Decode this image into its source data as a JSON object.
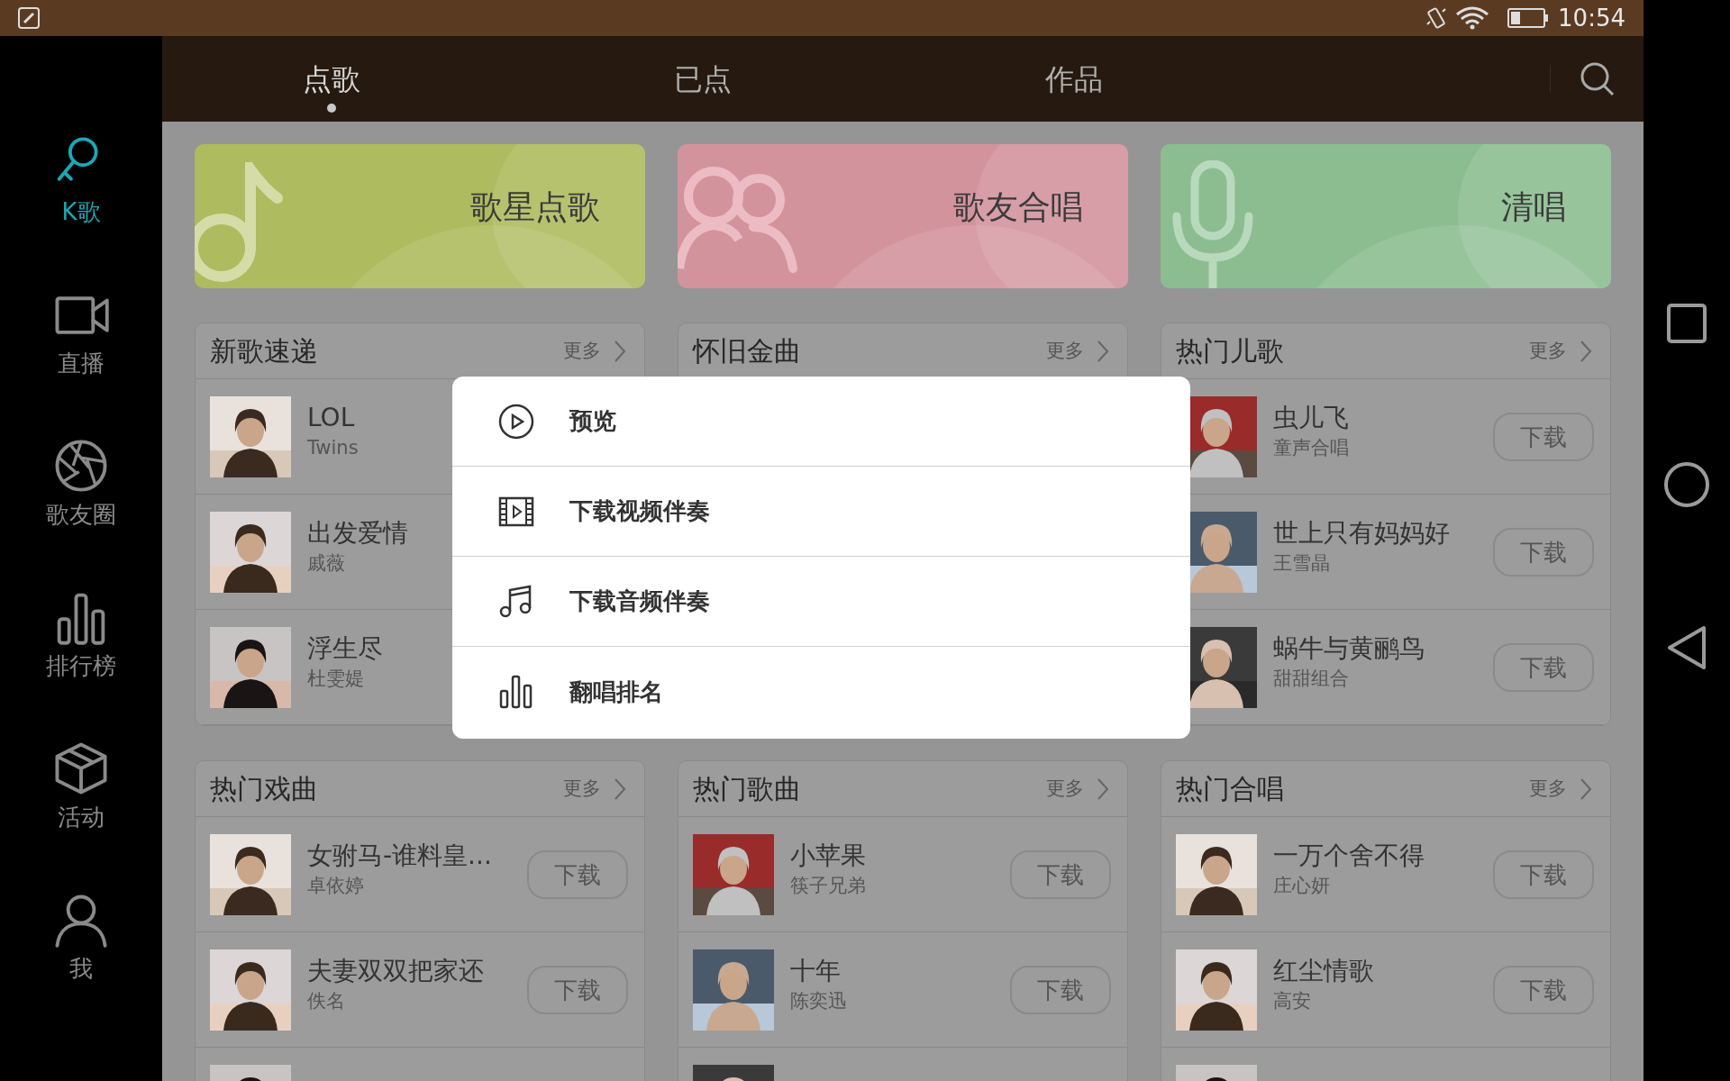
{
  "status_bar": {
    "time": "10:54"
  },
  "tabs": [
    {
      "label": "点歌",
      "selected": true
    },
    {
      "label": "已点",
      "selected": false
    },
    {
      "label": "作品",
      "selected": false
    }
  ],
  "sidebar": {
    "items": [
      {
        "label": "K歌",
        "kind": "mic",
        "selected": true
      },
      {
        "label": "直播",
        "kind": "camera",
        "selected": false
      },
      {
        "label": "歌友圈",
        "kind": "aperture",
        "selected": false
      },
      {
        "label": "排行榜",
        "kind": "bars",
        "selected": false
      },
      {
        "label": "活动",
        "kind": "box",
        "selected": false
      },
      {
        "label": "我",
        "kind": "person",
        "selected": false
      }
    ]
  },
  "banners": [
    {
      "label": "歌星点歌",
      "kind": "note",
      "color": "#aebb5e"
    },
    {
      "label": "歌友合唱",
      "kind": "people",
      "color": "#d3939d"
    },
    {
      "label": "清唱",
      "kind": "mic",
      "color": "#8cbd91"
    }
  ],
  "sections": [
    {
      "title": "新歌速递",
      "more": "更多",
      "rows": [
        {
          "kind": "song",
          "title": "LOL",
          "artist": "Twins"
        },
        {
          "kind": "song",
          "title": "出发爱情",
          "artist": "戚薇"
        },
        {
          "kind": "song",
          "title": "浮生尽",
          "artist": "杜雯媞"
        }
      ]
    },
    {
      "title": "怀旧金曲",
      "more": "更多"
    },
    {
      "title": "热门儿歌",
      "more": "更多",
      "rows": [
        {
          "kind": "song",
          "title": "虫儿飞",
          "artist": "童声合唱",
          "action": "下载"
        },
        {
          "kind": "song",
          "title": "世上只有妈妈好",
          "artist": "王雪晶",
          "action": "下载"
        },
        {
          "kind": "song",
          "title": "蜗牛与黄鹂鸟",
          "artist": "甜甜组合",
          "action": "下载"
        }
      ]
    },
    {
      "title": "热门戏曲",
      "more": "更多",
      "rows": [
        {
          "kind": "song",
          "title": "女驸马-谁料皇...",
          "artist": "卓依婷",
          "action": "下载"
        },
        {
          "kind": "song",
          "title": "夫妻双双把家还",
          "artist": "佚名",
          "action": "下载"
        },
        {
          "kind": "partial"
        }
      ]
    },
    {
      "title": "热门歌曲",
      "more": "更多",
      "rows": [
        {
          "kind": "song",
          "title": "小苹果",
          "artist": "筷子兄弟",
          "action": "下载"
        },
        {
          "kind": "song",
          "title": "十年",
          "artist": "陈奕迅",
          "action": "下载"
        },
        {
          "kind": "partial"
        }
      ]
    },
    {
      "title": "热门合唱",
      "more": "更多",
      "rows": [
        {
          "kind": "song",
          "title": "一万个舍不得",
          "artist": "庄心妍",
          "action": "下载"
        },
        {
          "kind": "song",
          "title": "红尘情歌",
          "artist": "高安",
          "action": "下载"
        },
        {
          "kind": "partial"
        }
      ]
    }
  ],
  "menu": {
    "items": [
      {
        "label": "预览",
        "kind": "play"
      },
      {
        "label": "下载视频伴奏",
        "kind": "film"
      },
      {
        "label": "下载音频伴奏",
        "kind": "music"
      },
      {
        "label": "翻唱排名",
        "kind": "bars"
      }
    ]
  }
}
